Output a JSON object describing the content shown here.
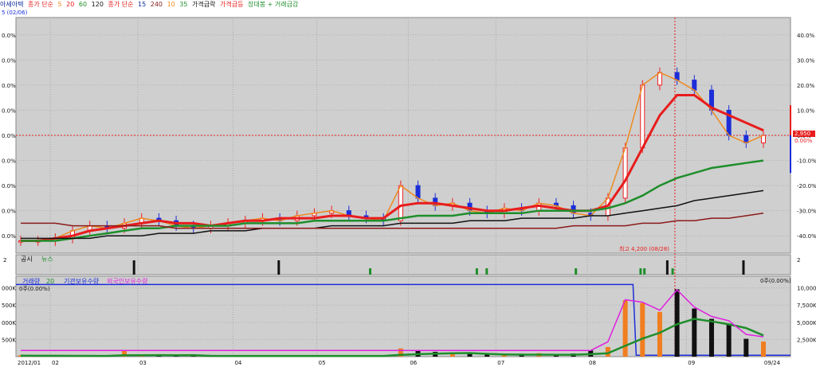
{
  "header": {
    "stock_name": "아세아텍",
    "ma_price_label": "종가 단순",
    "ma_price_periods": [
      "5",
      "20",
      "60",
      "120"
    ],
    "ma_price_label2": "종가 단순",
    "ma_price_periods2": [
      "15",
      "240",
      "10",
      "35"
    ],
    "surge_label": "가격급락",
    "drop_label": "가격급등",
    "extra_label": "장대봉 + 거래급감",
    "info_line": "5 (02/06)"
  },
  "colors": {
    "panel_bg": "#cfcfcf",
    "up": "#ee2020",
    "down": "#1c2ed8",
    "ma5": "#ee8a20",
    "ma20": "#e81c1c",
    "ma60": "#1f8e2b",
    "ma120": "#111111",
    "ma240": "#8b1a1a",
    "volume_up": "#f07e20",
    "volume_down": "#111111",
    "vol_ma": "#1f8e2b",
    "foreign": "#e020e0"
  },
  "chart_data": [
    {
      "type": "line",
      "name": "price-panel",
      "left_ticks": [
        ".0%",
        "0.0%",
        "0.0%",
        "0.0%",
        "0.0%",
        "0.0%",
        "0.0%",
        "0.0%",
        "0.0%",
        "0.0%"
      ],
      "right_ticks": [
        "40.0%",
        "30.0%",
        "20.0%",
        "10.0%",
        "0.0%",
        "-10.0%",
        "-20.0%",
        "-30.0%",
        "-40.0%"
      ],
      "right_tick_values": [
        40,
        30,
        20,
        10,
        0,
        -10,
        -20,
        -30,
        -40
      ],
      "ylim": [
        -45,
        45
      ],
      "current_price_label": "2,950",
      "current_pct_label": "0.00%",
      "high_annotation": "최고 4,200 (08/28)",
      "x_labels": [
        "2012/01",
        "02",
        "03",
        "04",
        "05",
        "06",
        "07",
        "08",
        "09",
        "09/24"
      ],
      "series": [
        {
          "name": "5",
          "values": [
            -42,
            -42,
            -41,
            -38,
            -36,
            -37,
            -35,
            -33,
            -34,
            -36,
            -37,
            -36,
            -35,
            -34,
            -33,
            -34,
            -32,
            -31,
            -30,
            -32,
            -33,
            -34,
            -20,
            -25,
            -28,
            -27,
            -30,
            -31,
            -29,
            -30,
            -27,
            -28,
            -31,
            -32,
            -25,
            -5,
            20,
            25,
            22,
            18,
            10,
            0,
            -3,
            0
          ]
        },
        {
          "name": "20",
          "values": [
            -42,
            -42,
            -41,
            -40,
            -38,
            -37,
            -36,
            -35,
            -34,
            -35,
            -35,
            -36,
            -35,
            -34,
            -34,
            -33,
            -33,
            -33,
            -32,
            -32,
            -33,
            -33,
            -28,
            -27,
            -27,
            -28,
            -29,
            -30,
            -30,
            -29,
            -28,
            -29,
            -30,
            -30,
            -28,
            -18,
            -5,
            8,
            16,
            16,
            11,
            8,
            5,
            2
          ]
        },
        {
          "name": "60",
          "values": [
            -42,
            -42,
            -42,
            -41,
            -40,
            -39,
            -38,
            -37,
            -37,
            -36,
            -36,
            -36,
            -36,
            -35,
            -35,
            -35,
            -35,
            -34,
            -34,
            -34,
            -34,
            -34,
            -33,
            -32,
            -32,
            -32,
            -31,
            -31,
            -31,
            -31,
            -30,
            -30,
            -30,
            -30,
            -29,
            -27,
            -24,
            -20,
            -17,
            -15,
            -13,
            -12,
            -11,
            -10
          ]
        },
        {
          "name": "120",
          "values": [
            -41,
            -41,
            -41,
            -41,
            -41,
            -40,
            -40,
            -40,
            -39,
            -39,
            -39,
            -38,
            -38,
            -38,
            -37,
            -37,
            -37,
            -37,
            -36,
            -36,
            -36,
            -36,
            -35,
            -35,
            -35,
            -35,
            -34,
            -34,
            -34,
            -33,
            -33,
            -33,
            -33,
            -32,
            -32,
            -31,
            -30,
            -29,
            -28,
            -26,
            -25,
            -24,
            -23,
            -22
          ]
        },
        {
          "name": "240",
          "values": [
            -35,
            -35,
            -35,
            -36,
            -36,
            -36,
            -36,
            -36,
            -36,
            -37,
            -37,
            -37,
            -37,
            -37,
            -37,
            -37,
            -37,
            -37,
            -37,
            -37,
            -37,
            -37,
            -37,
            -37,
            -37,
            -37,
            -37,
            -37,
            -37,
            -37,
            -37,
            -37,
            -36,
            -36,
            -36,
            -36,
            -35,
            -35,
            -34,
            -34,
            -33,
            -33,
            -32,
            -31
          ]
        }
      ]
    },
    {
      "type": "bar",
      "name": "disclosure-panel",
      "legend": [
        "공시",
        "뉴스"
      ],
      "right_ticks": [
        "2"
      ],
      "left_ticks": [
        "2"
      ],
      "events": [
        {
          "t": 0.155,
          "kind": "공시"
        },
        {
          "t": 0.345,
          "kind": "공시"
        },
        {
          "t": 0.465,
          "kind": "뉴스"
        },
        {
          "t": 0.605,
          "kind": "뉴스"
        },
        {
          "t": 0.618,
          "kind": "뉴스"
        },
        {
          "t": 0.735,
          "kind": "뉴스"
        },
        {
          "t": 0.82,
          "kind": "뉴스"
        },
        {
          "t": 0.825,
          "kind": "뉴스"
        },
        {
          "t": 0.855,
          "kind": "공시"
        },
        {
          "t": 0.862,
          "kind": "뉴스"
        },
        {
          "t": 0.955,
          "kind": "공시"
        }
      ]
    },
    {
      "type": "bar",
      "name": "volume-panel",
      "legend": [
        "거래량",
        "20",
        "기관보유수량",
        "외국인보유수량"
      ],
      "top_left_label": "0주(0.00%)",
      "top_right_label": "0주(0.00%)",
      "left_ticks": [
        "000K",
        "500K",
        "000K",
        "500K"
      ],
      "right_ticks": [
        "10,000K",
        "7,500K",
        "5,000K",
        "2,500K"
      ],
      "right_tick_values": [
        10000,
        7500,
        5000,
        2500
      ],
      "ylim": [
        0,
        11000
      ],
      "volumes": [
        200,
        150,
        180,
        120,
        160,
        140,
        900,
        200,
        150,
        130,
        170,
        160,
        150,
        140,
        160,
        150,
        140,
        150,
        160,
        170,
        150,
        140,
        1200,
        900,
        700,
        500,
        400,
        380,
        350,
        420,
        500,
        300,
        450,
        900,
        1400,
        8200,
        7800,
        6500,
        9800,
        7000,
        5500,
        4800,
        2600,
        2200
      ]
    }
  ]
}
